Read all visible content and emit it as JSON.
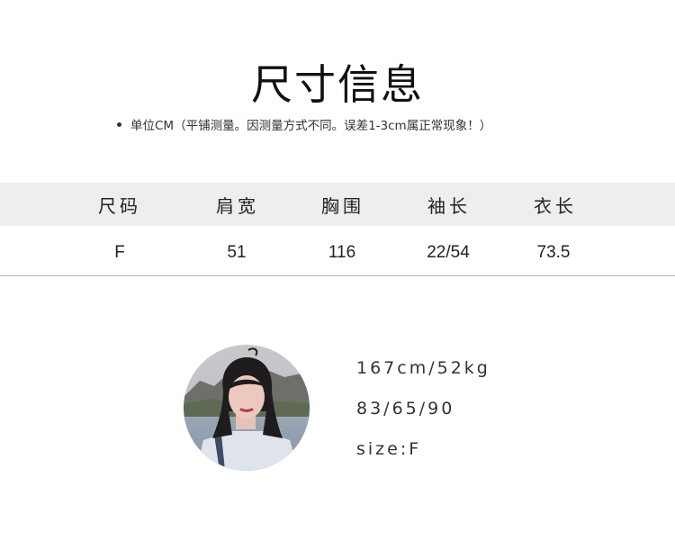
{
  "title": "尺寸信息",
  "subtitle": "单位CM（平铺测量。因测量方式不同。误差1-3cm属正常现象！）",
  "size_table": {
    "headers": [
      "尺码",
      "肩宽",
      "胸围",
      "袖长",
      "衣长"
    ],
    "rows": [
      [
        "F",
        "51",
        "116",
        "22/54",
        "73.5"
      ]
    ]
  },
  "model": {
    "height_weight": "167cm/52kg",
    "measurements": "83/65/90",
    "size": "size:F"
  }
}
